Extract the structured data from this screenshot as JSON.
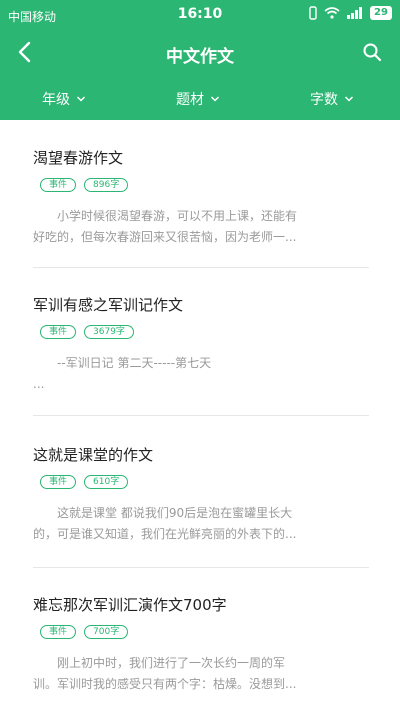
{
  "statusbar": {
    "carrier": "中国移动",
    "time": "16:10",
    "battery": "29"
  },
  "navbar": {
    "title": "中文作文"
  },
  "filters": [
    {
      "label": "年级"
    },
    {
      "label": "题材"
    },
    {
      "label": "字数"
    }
  ],
  "articles": [
    {
      "title": "渴望春游作文",
      "tags": [
        "事件",
        "896字"
      ],
      "excerpt_line1": "小学时候很渴望春游，可以不用上课，还能有",
      "excerpt_line2": "好吃的，但每次春游回来又很苦恼，因为老师一..."
    },
    {
      "title": "军训有感之军训记作文",
      "tags": [
        "事件",
        "3679字"
      ],
      "excerpt_line1": "--军训日记 第二天-----第七天",
      "excerpt_line2": "..."
    },
    {
      "title": "这就是课堂的作文",
      "tags": [
        "事件",
        "610字"
      ],
      "excerpt_line1": "这就是课堂 都说我们90后是泡在蜜罐里长大",
      "excerpt_line2": "的，可是谁又知道，我们在光鲜亮丽的外表下的..."
    },
    {
      "title": "难忘那次军训汇演作文700字",
      "tags": [
        "事件",
        "700字"
      ],
      "excerpt_line1": "刚上初中时，我们进行了一次长约一周的军",
      "excerpt_line2": "训。军训时我的感受只有两个字：枯燥。没想到..."
    }
  ]
}
